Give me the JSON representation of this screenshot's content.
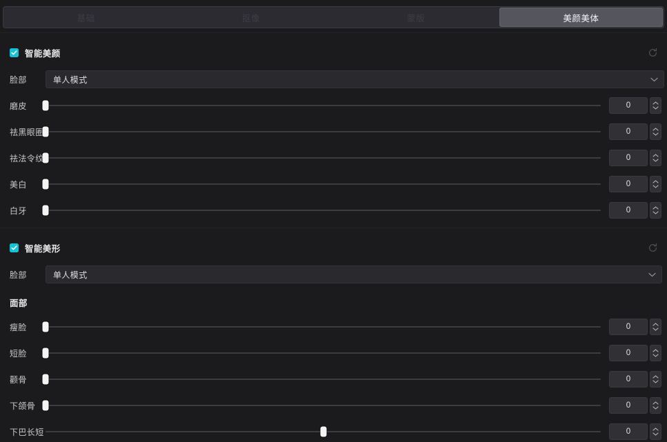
{
  "window": {
    "title": "美颜美体",
    "accent_color": "#14c2d6",
    "background_color": "#1b1b1d",
    "active_tab_color": "#55555e"
  },
  "tabs": [
    {
      "label": "基础",
      "active": false
    },
    {
      "label": "抠像",
      "active": false
    },
    {
      "label": "蒙版",
      "active": false
    },
    {
      "label": "美颜美体",
      "active": true
    }
  ],
  "sections": [
    {
      "id": "smart-beauty",
      "title": "智能美颜",
      "checked": true,
      "reset_icon": "reset-circular-arrow-icon",
      "select": {
        "label": "脸部",
        "value": "单人模式",
        "caret_icon": "chevron-down-icon"
      },
      "sliders": [
        {
          "label": "磨皮",
          "value": "0",
          "percent": 0
        },
        {
          "label": "祛黑眼圈",
          "value": "0",
          "percent": 0
        },
        {
          "label": "祛法令纹",
          "value": "0",
          "percent": 0
        },
        {
          "label": "美白",
          "value": "0",
          "percent": 0
        },
        {
          "label": "白牙",
          "value": "0",
          "percent": 0
        }
      ]
    },
    {
      "id": "smart-reshape",
      "title": "智能美形",
      "checked": true,
      "reset_icon": "reset-circular-arrow-icon",
      "select": {
        "label": "脸部",
        "value": "单人模式",
        "caret_icon": "chevron-down-icon"
      },
      "group_title": "面部",
      "sliders": [
        {
          "label": "瘦脸",
          "value": "0",
          "percent": 0
        },
        {
          "label": "短脸",
          "value": "0",
          "percent": 0
        },
        {
          "label": "颧骨",
          "value": "0",
          "percent": 0
        },
        {
          "label": "下颌骨",
          "value": "0",
          "percent": 0
        },
        {
          "label": "下巴长短",
          "value": "0",
          "percent": 50
        }
      ]
    }
  ],
  "spinner": {
    "up_icon": "chevron-up-icon",
    "down_icon": "chevron-down-icon"
  }
}
